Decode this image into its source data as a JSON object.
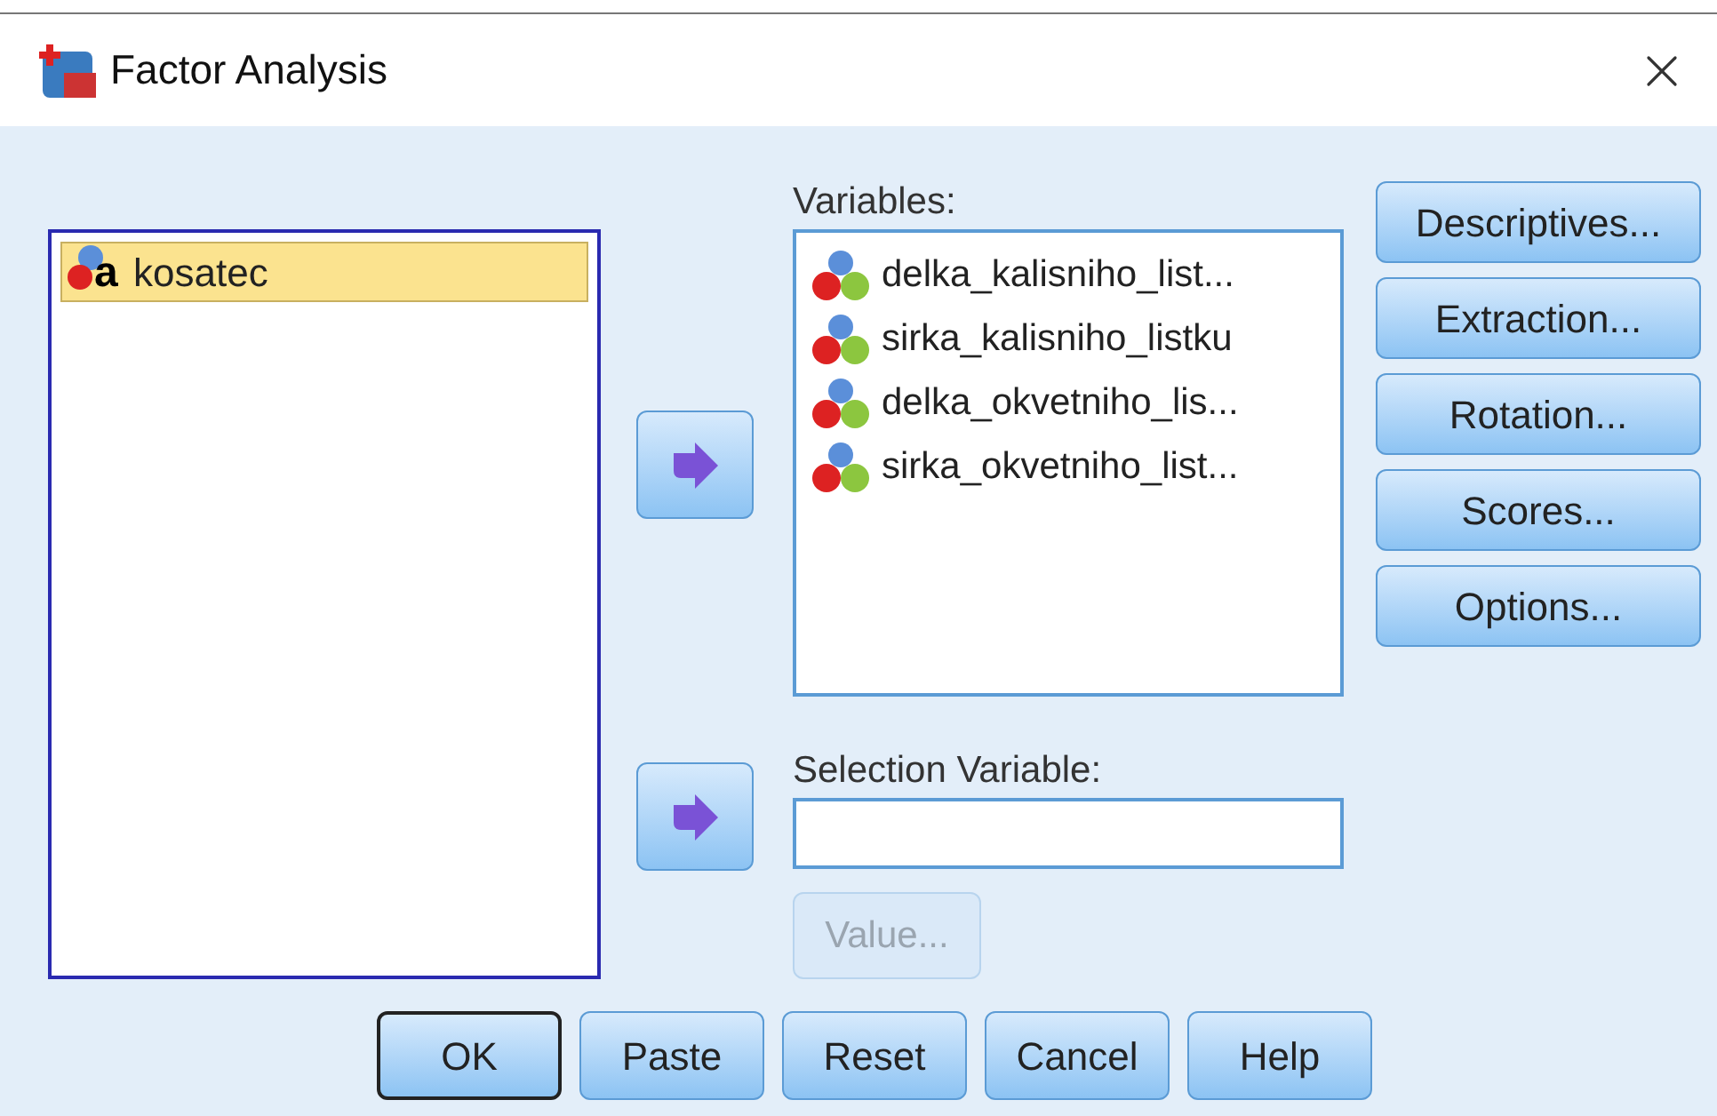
{
  "window": {
    "title": "Factor Analysis"
  },
  "source_list": {
    "items": [
      {
        "name": "kosatec",
        "kind": "nominal",
        "glyph": "a",
        "selected": true
      }
    ]
  },
  "variables": {
    "label": "Variables:",
    "items": [
      {
        "name": "delka_kalisniho_list...",
        "kind": "scale",
        "selected": false
      },
      {
        "name": "sirka_kalisniho_listku",
        "kind": "scale",
        "selected": false
      },
      {
        "name": "delka_okvetniho_lis...",
        "kind": "scale",
        "selected": false
      },
      {
        "name": "sirka_okvetniho_list...",
        "kind": "scale",
        "selected": false
      }
    ]
  },
  "selection_variable": {
    "label": "Selection Variable:",
    "value_button": {
      "label": "Value...",
      "disabled": true
    }
  },
  "side_buttons": [
    "Descriptives...",
    "Extraction...",
    "Rotation...",
    "Scores...",
    "Options..."
  ],
  "bottom_buttons": [
    {
      "label": "OK",
      "default": true
    },
    {
      "label": "Paste",
      "default": false
    },
    {
      "label": "Reset",
      "default": false
    },
    {
      "label": "Cancel",
      "default": false
    },
    {
      "label": "Help",
      "default": false
    }
  ]
}
